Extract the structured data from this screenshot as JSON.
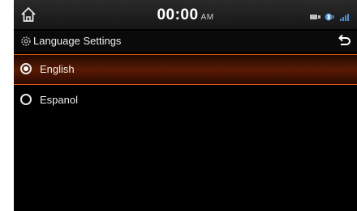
{
  "statusbar": {
    "time": "00:00",
    "ampm": "AM",
    "icons": [
      "media-icon",
      "bluetooth-icon",
      "signal-icon"
    ]
  },
  "header": {
    "title": "Language Settings"
  },
  "languages": [
    {
      "label": "English",
      "selected": true
    },
    {
      "label": "Espanol",
      "selected": false
    }
  ],
  "colors": {
    "accent": "#e0551a",
    "background": "#000000"
  }
}
